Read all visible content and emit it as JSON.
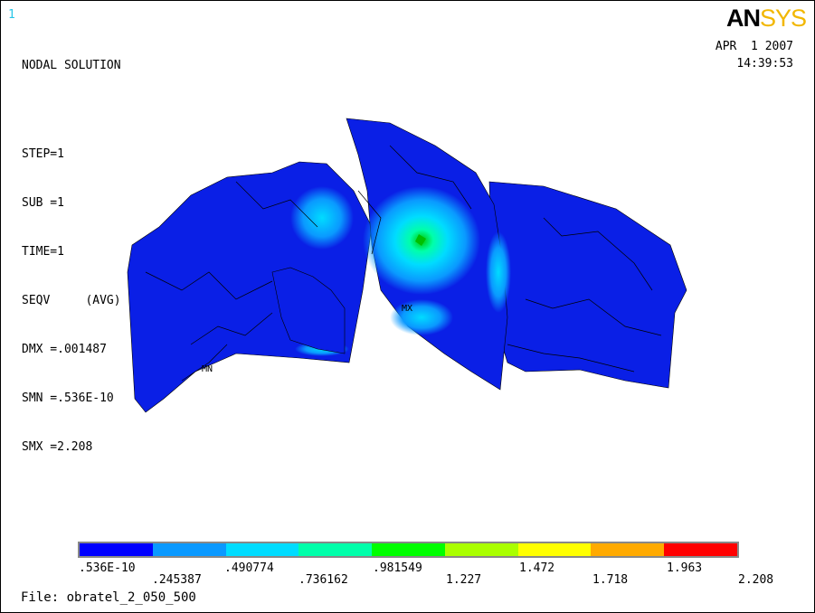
{
  "window_number": "1",
  "logo": {
    "part1": "AN",
    "part2": "SYS"
  },
  "info": {
    "title": "NODAL SOLUTION",
    "lines": [
      "STEP=1",
      "SUB =1",
      "TIME=1",
      "SEQV     (AVG)",
      "DMX =.001487",
      "SMN =.536E-10",
      "SMX =2.208"
    ]
  },
  "date": "APR  1 2007",
  "time": "14:39:53",
  "markers": {
    "mx": "MX",
    "mn": "MN"
  },
  "legend": {
    "colors": [
      "#0000ff",
      "#0a99ff",
      "#00dcff",
      "#00ffaa",
      "#00ff00",
      "#aaff00",
      "#ffff00",
      "#ffaa00",
      "#ff0000"
    ],
    "labels_top": [
      ".536E-10",
      ".490774",
      ".981549",
      "1.472",
      "1.963"
    ],
    "labels_bottom": [
      ".245387",
      ".736162",
      "1.227",
      "1.718",
      "2.208"
    ]
  },
  "file": "File: obratel_2_050_500"
}
